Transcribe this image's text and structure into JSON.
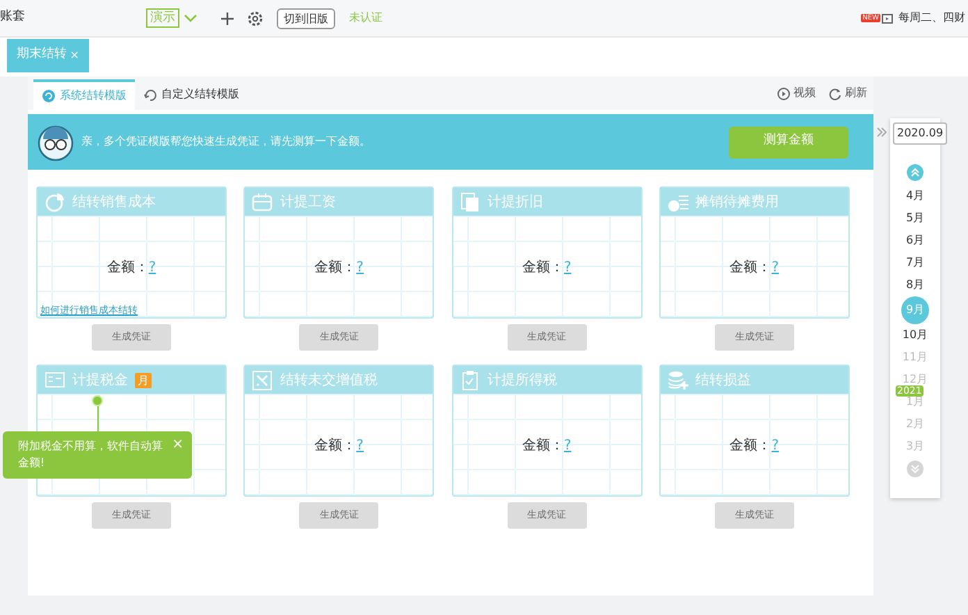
{
  "top_bar": {
    "account": "账套",
    "demo_tag": "演示",
    "switch_button": "切到旧版",
    "auth_status": "未认证",
    "promo_badge": "NEW",
    "promo_text": "每周二、四财"
  },
  "tabs": [
    {
      "label": "期末结转",
      "close": "×",
      "selected": true
    }
  ],
  "subtabs": [
    {
      "label": "系统结转模版",
      "selected": true
    },
    {
      "label": "自定义结转模版",
      "selected": false
    }
  ],
  "actions": [
    {
      "kind": "video",
      "label": "视频"
    },
    {
      "kind": "refresh",
      "label": "刷新"
    }
  ],
  "banner": {
    "text": "亲，多个凭证模版帮您快速生成凭证，请先测算一下金额。",
    "button": "测算金额"
  },
  "cards": [
    {
      "title": "结转销售成本",
      "amount_label": "金额：",
      "amount": "?",
      "link": "如何进行销售成本结转",
      "button": "生成凭证",
      "disabled": true
    },
    {
      "title": "计提工资",
      "amount_label": "金额：",
      "amount": "?",
      "button": "生成凭证",
      "disabled": true
    },
    {
      "title": "计提折旧",
      "amount_label": "金额：",
      "amount": "?",
      "button": "生成凭证",
      "disabled": true
    },
    {
      "title": "摊销待摊费用",
      "amount_label": "金额：",
      "amount": "?",
      "button": "生成凭证",
      "disabled": true
    },
    {
      "title": "计提税金",
      "badge": "月",
      "button": "生成凭证",
      "disabled": true,
      "tooltip": {
        "text": "附加税金不用算，软件自动算金额!",
        "close": "×"
      }
    },
    {
      "title": "结转未交增值税",
      "amount_label": "金额：",
      "amount": "?",
      "button": "生成凭证",
      "disabled": true
    },
    {
      "title": "计提所得税",
      "amount_label": "金额：",
      "amount": "?",
      "button": "生成凭证",
      "disabled": true
    },
    {
      "title": "结转损益",
      "amount_label": "金额：",
      "amount": "?",
      "button": "生成凭证",
      "disabled": true
    }
  ],
  "month_sidebar": {
    "current": "2020.09",
    "months": [
      {
        "label": "4月",
        "selected": false,
        "disabled": false
      },
      {
        "label": "5月",
        "selected": false,
        "disabled": false
      },
      {
        "label": "6月",
        "selected": false,
        "disabled": false
      },
      {
        "label": "7月",
        "selected": false,
        "disabled": false
      },
      {
        "label": "8月",
        "selected": false,
        "disabled": false
      },
      {
        "label": "9月",
        "selected": true,
        "disabled": false
      },
      {
        "label": "10月",
        "selected": false,
        "disabled": false
      },
      {
        "label": "11月",
        "selected": false,
        "disabled": true
      },
      {
        "label": "12月",
        "selected": false,
        "disabled": true
      },
      {
        "label": "1月",
        "selected": false,
        "disabled": true,
        "year_tag": "2021"
      },
      {
        "label": "2月",
        "selected": false,
        "disabled": true
      },
      {
        "label": "3月",
        "selected": false,
        "disabled": true
      }
    ]
  }
}
